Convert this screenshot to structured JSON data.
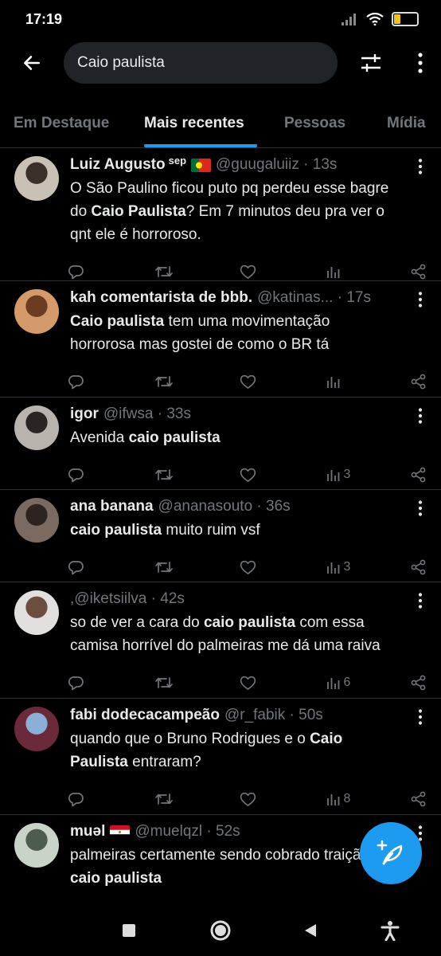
{
  "status": {
    "time": "17:19",
    "battery": "29"
  },
  "search": {
    "query": "Caio paulista"
  },
  "tabs": [
    {
      "label": "Em Destaque"
    },
    {
      "label": "Mais recentes"
    },
    {
      "label": "Pessoas"
    },
    {
      "label": "Mídia"
    }
  ],
  "tweets": [
    {
      "name": "Luiz Augusto",
      "name_extra": "sep",
      "flag": "portugal",
      "meta": "@guugaluiiz · 13s",
      "text_parts": [
        {
          "t": "O São Paulino ficou puto pq perdeu esse bagre do "
        },
        {
          "t": "Caio Paulista",
          "b": true
        },
        {
          "t": "? Em 7 minutos deu pra ver o qnt ele é horroroso."
        }
      ],
      "views": ""
    },
    {
      "name": "kah comentarista de bbb.",
      "meta": "@katinas... · 17s",
      "text_parts": [
        {
          "t": "Caio paulista",
          "b": true
        },
        {
          "t": " tem uma movimentação horrorosa mas gostei de como o BR tá"
        }
      ],
      "views": ""
    },
    {
      "name": "igor",
      "meta": "@ifwsa · 33s",
      "text_parts": [
        {
          "t": "Avenida "
        },
        {
          "t": "caio paulista",
          "b": true
        }
      ],
      "views": "3"
    },
    {
      "name": "ana banana",
      "meta": "@ananasouto · 36s",
      "text_parts": [
        {
          "t": "caio paulista",
          "b": true
        },
        {
          "t": " muito ruim vsf"
        }
      ],
      "views": "3"
    },
    {
      "name": "",
      "meta": ",@iketsiilva · 42s",
      "text_parts": [
        {
          "t": "so de ver a cara do "
        },
        {
          "t": "caio paulista",
          "b": true
        },
        {
          "t": " com essa camisa horrível do palmeiras me dá uma raiva"
        }
      ],
      "views": "6"
    },
    {
      "name": "fabi dodecacampeão",
      "meta": "@r_fabik · 50s",
      "text_parts": [
        {
          "t": "quando que o Bruno Rodrigues e o "
        },
        {
          "t": "Caio Paulista",
          "b": true
        },
        {
          "t": " entraram?"
        }
      ],
      "views": "8"
    },
    {
      "name": "muəl",
      "flag": "egypt",
      "meta": "@muelqzl · 52s",
      "text_parts": [
        {
          "t": "palmeiras certamente sendo cobrado traição de "
        },
        {
          "t": "caio paulista",
          "b": true
        }
      ],
      "views": ""
    }
  ],
  "colors": {
    "accent": "#1d9bf0",
    "muted": "#71767b",
    "text": "#e7e9ea",
    "divider": "#2f3336",
    "search_bg": "#202327"
  },
  "icons": {
    "back": "arrow-left-icon",
    "filter": "sliders-icon",
    "more": "more-vertical-icon",
    "reply": "reply-icon",
    "retweet": "retweet-icon",
    "like": "heart-icon",
    "views": "views-icon",
    "share": "share-icon",
    "compose": "compose-icon"
  }
}
